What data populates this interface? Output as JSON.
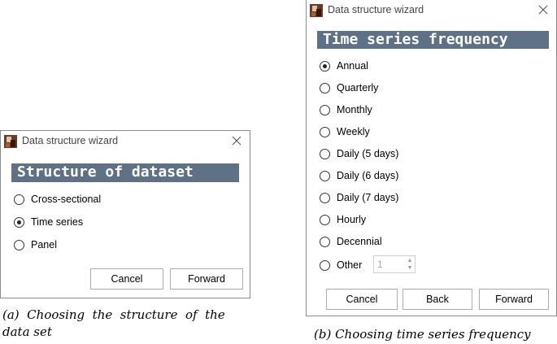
{
  "dialog_a": {
    "title": "Data structure wizard",
    "header": "Structure of dataset",
    "options": [
      {
        "label": "Cross-sectional",
        "checked": false
      },
      {
        "label": "Time series",
        "checked": true
      },
      {
        "label": "Panel",
        "checked": false
      }
    ],
    "buttons": {
      "cancel": "Cancel",
      "forward": "Forward"
    }
  },
  "dialog_b": {
    "title": "Data structure wizard",
    "header": "Time series frequency",
    "options": [
      {
        "label": "Annual",
        "checked": true
      },
      {
        "label": "Quarterly",
        "checked": false
      },
      {
        "label": "Monthly",
        "checked": false
      },
      {
        "label": "Weekly",
        "checked": false
      },
      {
        "label": "Daily (5 days)",
        "checked": false
      },
      {
        "label": "Daily (6 days)",
        "checked": false
      },
      {
        "label": "Daily (7 days)",
        "checked": false
      },
      {
        "label": "Hourly",
        "checked": false
      },
      {
        "label": "Decennial",
        "checked": false
      },
      {
        "label": "Other",
        "checked": false
      }
    ],
    "other_value": "1",
    "buttons": {
      "cancel": "Cancel",
      "back": "Back",
      "forward": "Forward"
    }
  },
  "captions": {
    "a_line1": "(a)  Choosing  the  structure  of  the",
    "a_line2": "data set",
    "b": "(b) Choosing time series frequency"
  },
  "colors": {
    "header_bg": "#5e7186",
    "header_text": "#ffffff"
  },
  "icons": {
    "app": "gretl-app-icon",
    "close": "close-icon"
  }
}
